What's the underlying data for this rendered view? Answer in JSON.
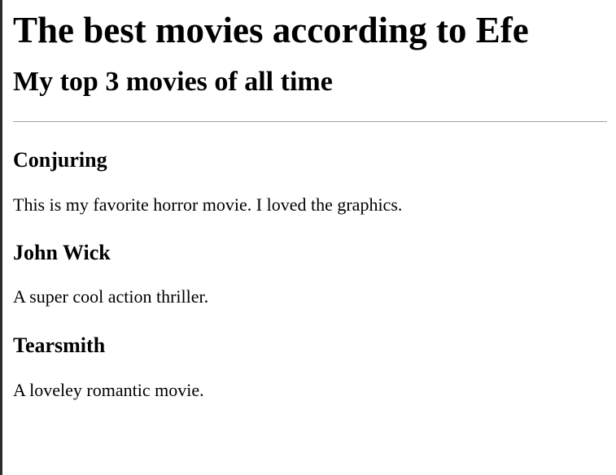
{
  "page": {
    "title": "The best movies according to Efe",
    "subtitle": "My top 3 movies of all time"
  },
  "movies": [
    {
      "name": "Conjuring",
      "description": "This is my favorite horror movie. I loved the graphics."
    },
    {
      "name": "John Wick",
      "description": "A super cool action thriller."
    },
    {
      "name": "Tearsmith",
      "description": "A loveley romantic movie."
    }
  ]
}
